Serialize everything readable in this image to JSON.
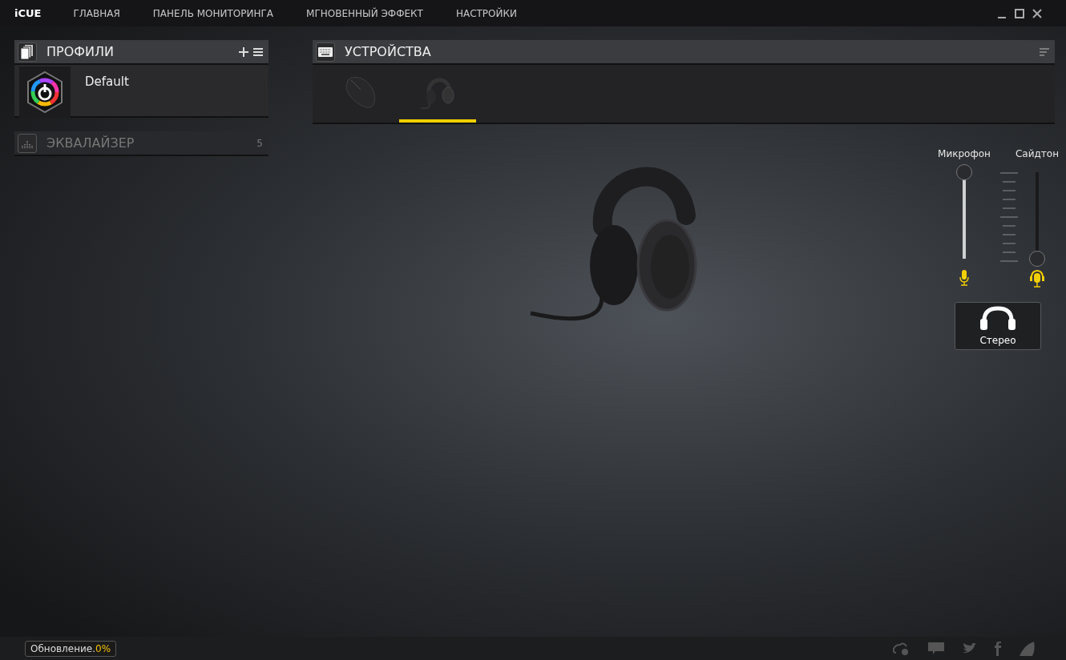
{
  "app": {
    "name": "iCUE"
  },
  "nav": [
    {
      "label": "ГЛАВНАЯ"
    },
    {
      "label": "ПАНЕЛЬ МОНИТОРИНГА"
    },
    {
      "label": "МГНОВЕННЫЙ ЭФФЕКТ"
    },
    {
      "label": "НАСТРОЙКИ"
    }
  ],
  "profiles": {
    "title": "ПРОФИЛИ",
    "items": [
      {
        "name": "Default"
      }
    ]
  },
  "equalizer": {
    "title": "ЭКВАЛАЙЗЕР",
    "count": "5"
  },
  "devices": {
    "title": "УСТРОЙСТВА",
    "items": [
      {
        "kind": "mouse",
        "selected": false
      },
      {
        "kind": "headset",
        "selected": true
      }
    ]
  },
  "sliders": [
    {
      "label": "Микрофон",
      "level": 1
    },
    {
      "label": "Сайдтон",
      "level": 0
    }
  ],
  "mode_button": {
    "label": "Стерео"
  },
  "status_bar": {
    "update_label": "Обновление.",
    "update_value": "0%"
  }
}
